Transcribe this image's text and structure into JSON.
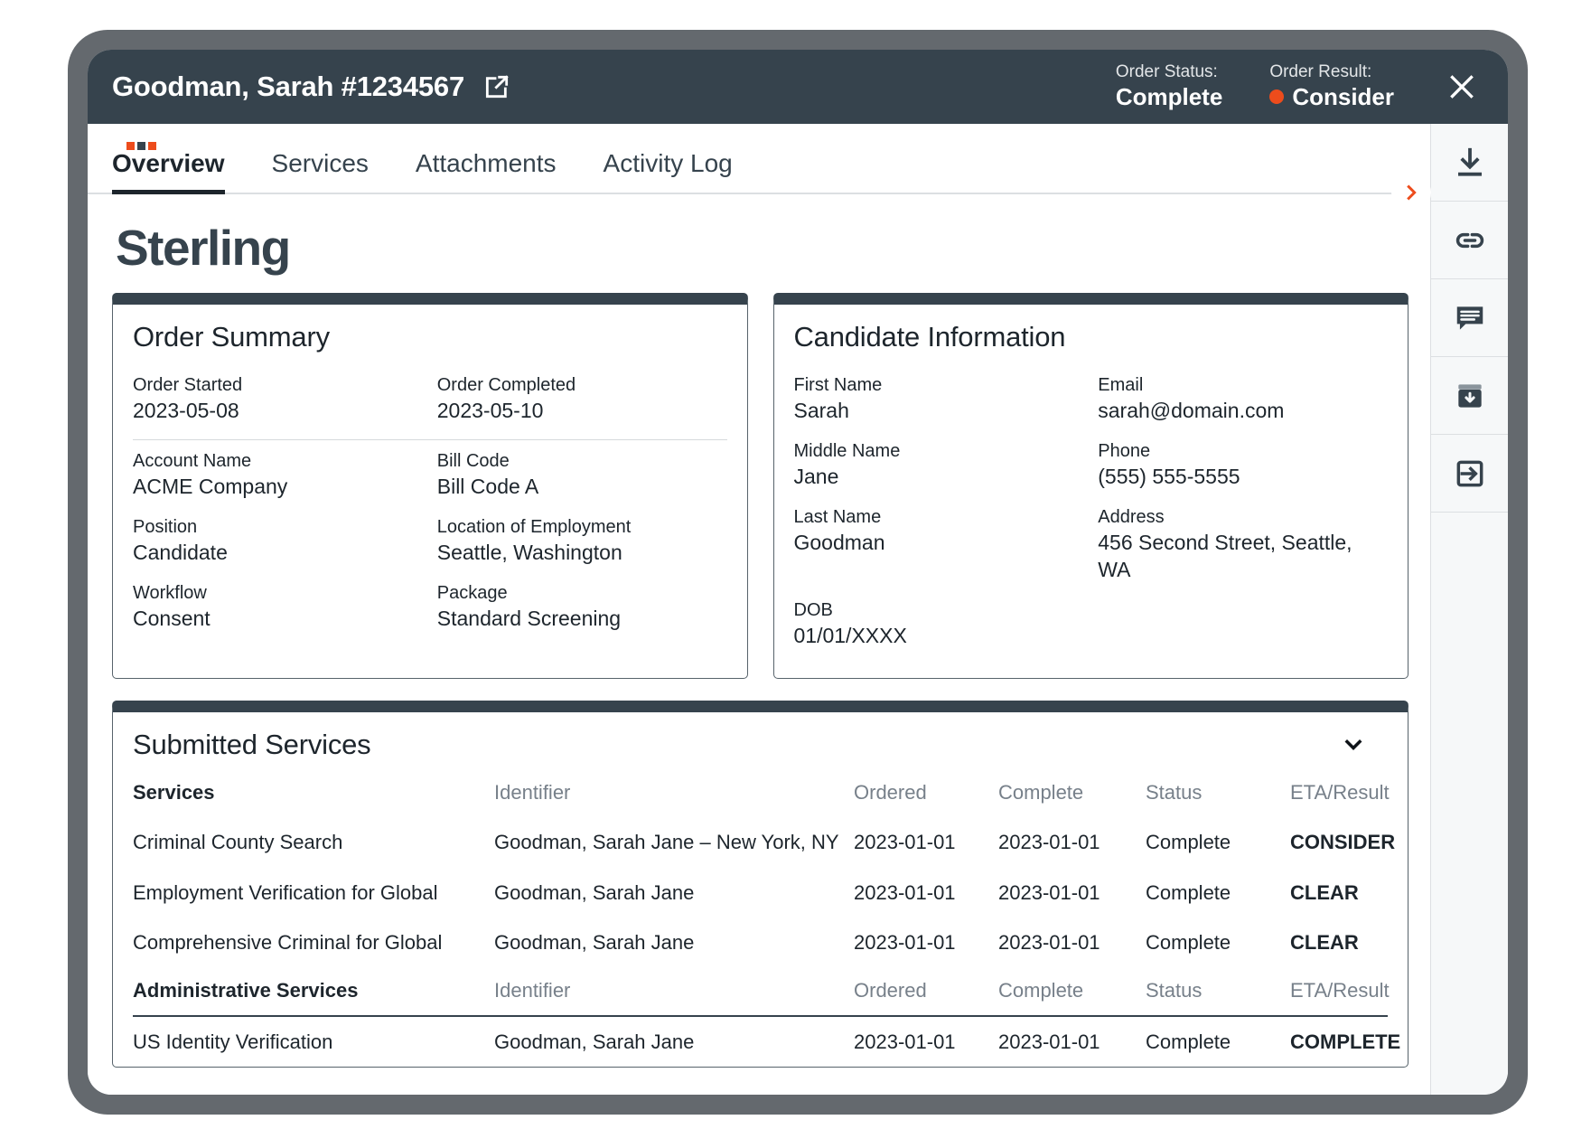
{
  "window": {
    "title": "Goodman, Sarah #1234567",
    "external_link_icon": "external-link-icon",
    "close_icon": "close-icon"
  },
  "header": {
    "order_status_label": "Order Status:",
    "order_status_value": "Complete",
    "order_result_label": "Order Result:",
    "order_result_value": "Consider",
    "order_result_color": "#ed4c1c"
  },
  "tabs": [
    {
      "label": "Overview",
      "active": true
    },
    {
      "label": "Services",
      "active": false
    },
    {
      "label": "Attachments",
      "active": false
    },
    {
      "label": "Activity Log",
      "active": false
    }
  ],
  "expand_pill": {
    "icon": "chevron-right-icon"
  },
  "brand": {
    "name": "Sterling"
  },
  "order_summary": {
    "title": "Order Summary",
    "fields": [
      {
        "label": "Order Started",
        "value": "2023-05-08"
      },
      {
        "label": "Order Completed",
        "value": "2023-05-10"
      },
      {
        "label": "Account Name",
        "value": "ACME Company"
      },
      {
        "label": "Bill Code",
        "value": "Bill Code A"
      },
      {
        "label": "Position",
        "value": "Candidate"
      },
      {
        "label": "Location of Employment",
        "value": "Seattle, Washington"
      },
      {
        "label": "Workflow",
        "value": "Consent"
      },
      {
        "label": "Package",
        "value": "Standard Screening"
      }
    ]
  },
  "candidate_information": {
    "title": "Candidate Information",
    "fields": [
      {
        "label": "First Name",
        "value": "Sarah"
      },
      {
        "label": "Email",
        "value": "sarah@domain.com"
      },
      {
        "label": "Middle Name",
        "value": "Jane"
      },
      {
        "label": "Phone",
        "value": "(555) 555-5555"
      },
      {
        "label": "Last Name",
        "value": "Goodman"
      },
      {
        "label": "Address",
        "value": "456 Second Street, Seattle, WA"
      },
      {
        "label": "DOB",
        "value": "01/01/XXXX"
      },
      {
        "label": "",
        "value": ""
      }
    ]
  },
  "submitted_services": {
    "title": "Submitted Services",
    "collapse_icon": "chevron-down-icon",
    "columns": [
      "Identifier",
      "Ordered",
      "Complete",
      "Status",
      "ETA/Result"
    ],
    "groups": [
      {
        "name": "Services",
        "rows": [
          {
            "service": "Criminal County Search",
            "identifier": "Goodman, Sarah Jane – New York, NY",
            "ordered": "2023-01-01",
            "complete": "2023-01-01",
            "status": "Complete",
            "result": "CONSIDER",
            "result_kind": "consider"
          },
          {
            "service": "Employment Verification for Global",
            "identifier": "Goodman, Sarah Jane",
            "ordered": "2023-01-01",
            "complete": "2023-01-01",
            "status": "Complete",
            "result": "CLEAR",
            "result_kind": "clear"
          },
          {
            "service": "Comprehensive Criminal for Global",
            "identifier": "Goodman, Sarah Jane",
            "ordered": "2023-01-01",
            "complete": "2023-01-01",
            "status": "Complete",
            "result": "CLEAR",
            "result_kind": "clear"
          }
        ]
      },
      {
        "name": "Administrative Services",
        "rows": [
          {
            "service": "US Identity Verification",
            "identifier": "Goodman, Sarah Jane",
            "ordered": "2023-01-01",
            "complete": "2023-01-01",
            "status": "Complete",
            "result": "COMPLETE",
            "result_kind": "complete"
          }
        ]
      }
    ]
  },
  "icon_rail": [
    {
      "icon": "download-icon"
    },
    {
      "icon": "link-icon"
    },
    {
      "icon": "comment-icon"
    },
    {
      "icon": "archive-download-icon"
    },
    {
      "icon": "logout-icon"
    }
  ]
}
